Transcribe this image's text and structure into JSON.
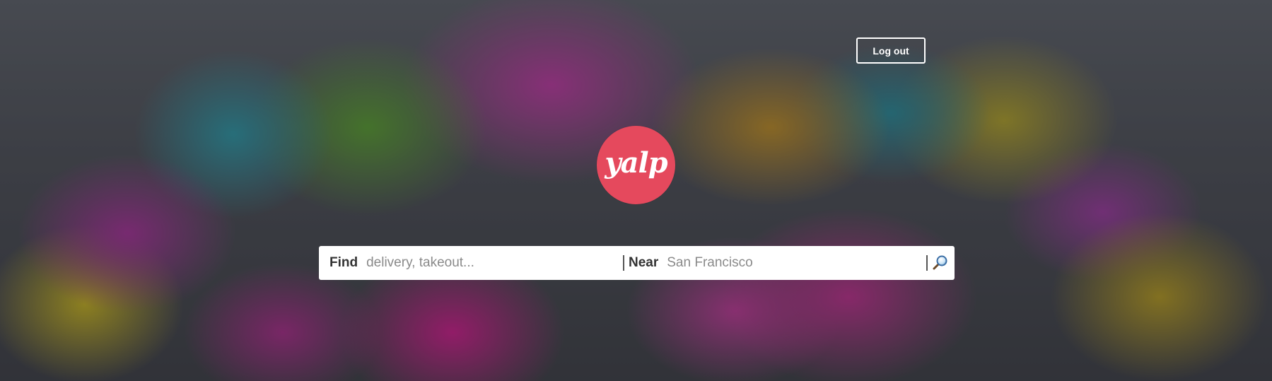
{
  "header": {
    "logout_label": "Log out"
  },
  "logo": {
    "text": "yalp",
    "color": "#e5495d"
  },
  "search": {
    "find_label": "Find",
    "find_placeholder": "delivery, takeout...",
    "find_value": "",
    "near_label": "Near",
    "near_placeholder": "San Francisco",
    "near_value": "",
    "submit_icon": "search-icon"
  }
}
